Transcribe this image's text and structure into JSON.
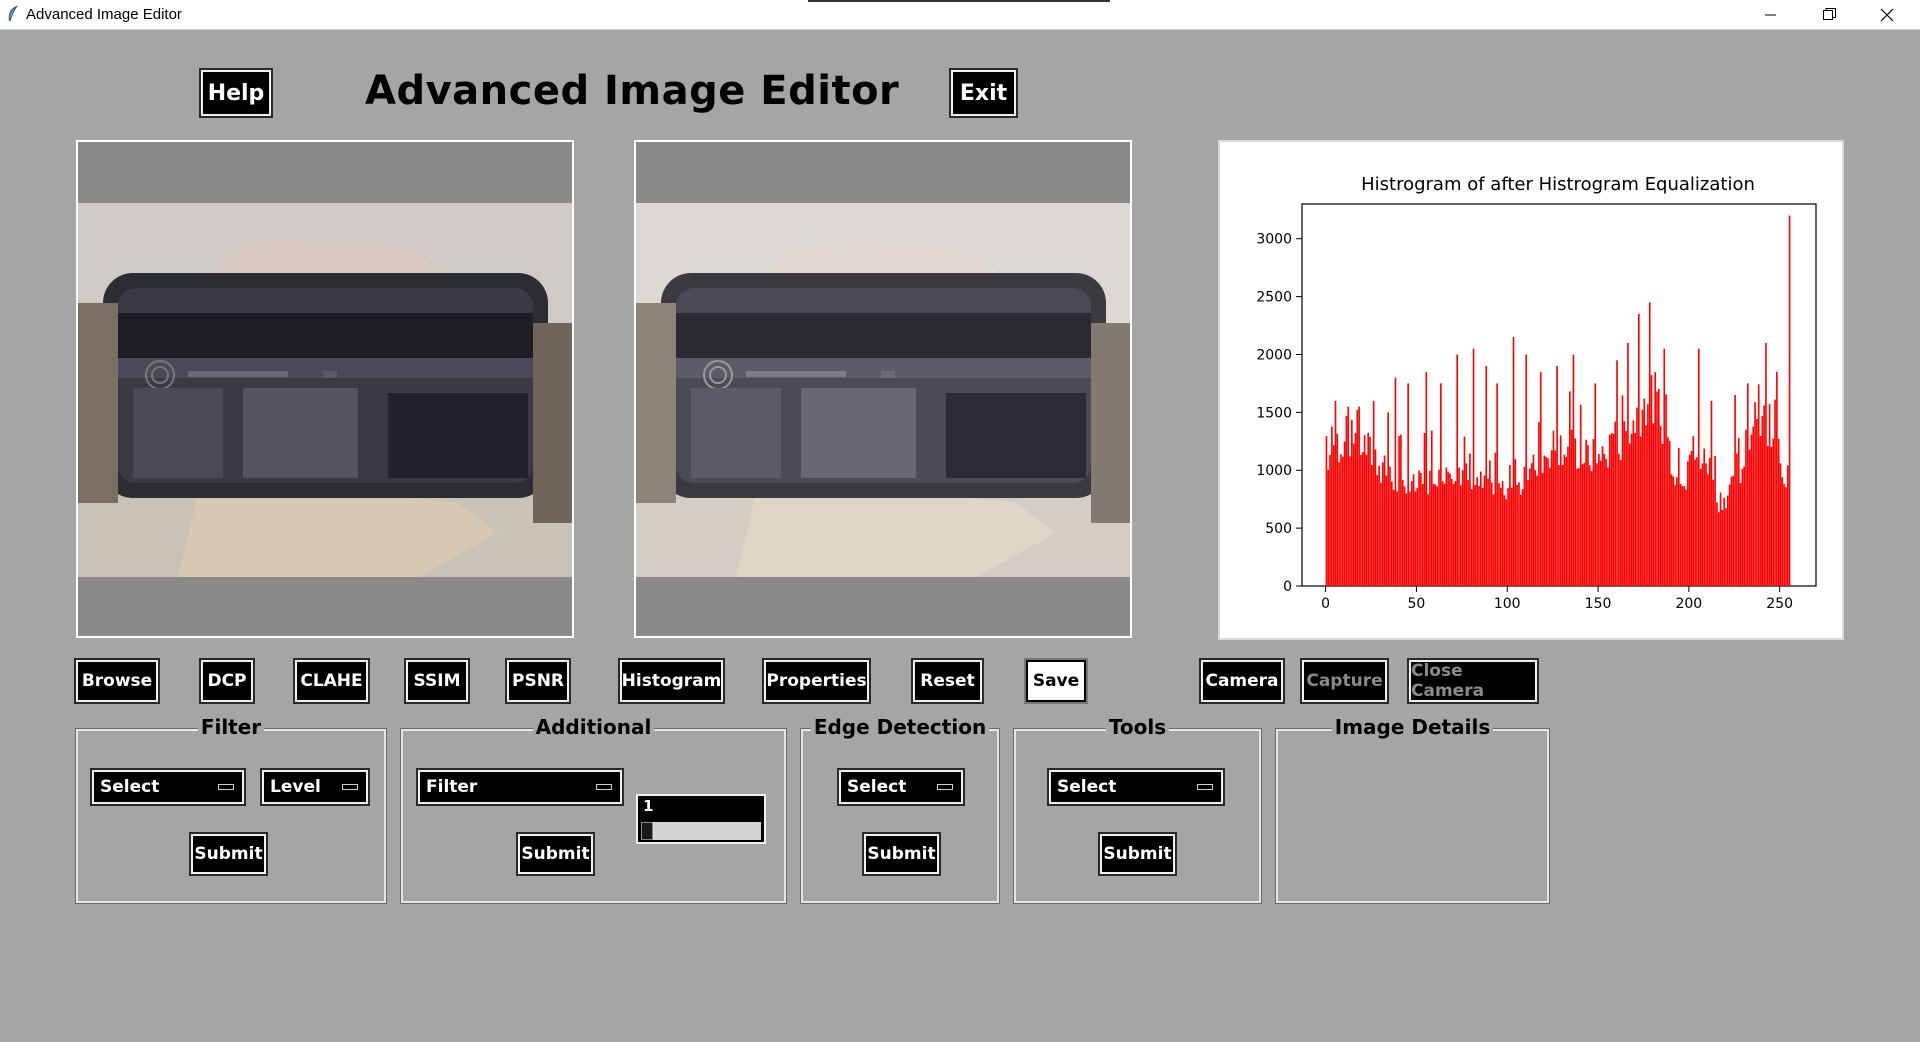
{
  "window": {
    "title": "Advanced Image Editor"
  },
  "header": {
    "title": "Advanced Image Editor",
    "help_label": "Help",
    "exit_label": "Exit"
  },
  "toolbar": {
    "browse": "Browse",
    "dcp": "DCP",
    "clahe": "CLAHE",
    "ssim": "SSIM",
    "psnr": "PSNR",
    "histogram": "Histogram",
    "properties": "Properties",
    "reset": "Reset",
    "save": "Save",
    "camera": "Camera",
    "capture": "Capture",
    "close_camera": "Close Camera"
  },
  "groups": {
    "filter": {
      "title": "Filter",
      "select": "Select",
      "level": "Level",
      "submit": "Submit"
    },
    "additional": {
      "title": "Additional",
      "select": "Filter",
      "scale_value": "1",
      "submit": "Submit"
    },
    "edge": {
      "title": "Edge Detection",
      "select": "Select",
      "submit": "Submit"
    },
    "tools": {
      "title": "Tools",
      "select": "Select",
      "submit": "Submit"
    },
    "details": {
      "title": "Image Details"
    }
  },
  "colors": {
    "background": "#a5a5a5",
    "button": "#000000",
    "histogram_bar": "#ff0000"
  },
  "chart_data": {
    "type": "bar",
    "title": "Histrogram of after Histrogram Equalization",
    "xlabel": "",
    "ylabel": "",
    "xlim": [
      -13,
      270
    ],
    "ylim": [
      0,
      3300
    ],
    "xticks": [
      0,
      50,
      100,
      150,
      200,
      250
    ],
    "yticks": [
      0,
      500,
      1000,
      1500,
      2000,
      2500,
      3000
    ],
    "grid": false,
    "x_range": [
      0,
      255
    ],
    "notes_from_image": "Dense histogram, mostly 800-1500 with many spikes; peaks near 175-180 (~2450) and spike at 255 (~3200).",
    "spikes": [
      {
        "x": 5,
        "y": 1600
      },
      {
        "x": 12,
        "y": 1550
      },
      {
        "x": 18,
        "y": 1550
      },
      {
        "x": 26,
        "y": 1600
      },
      {
        "x": 34,
        "y": 1500
      },
      {
        "x": 38,
        "y": 1800
      },
      {
        "x": 45,
        "y": 1750
      },
      {
        "x": 55,
        "y": 1850
      },
      {
        "x": 63,
        "y": 1750
      },
      {
        "x": 72,
        "y": 2000
      },
      {
        "x": 81,
        "y": 2050
      },
      {
        "x": 88,
        "y": 1900
      },
      {
        "x": 94,
        "y": 1750
      },
      {
        "x": 103,
        "y": 2150
      },
      {
        "x": 110,
        "y": 2000
      },
      {
        "x": 118,
        "y": 1850
      },
      {
        "x": 127,
        "y": 1900
      },
      {
        "x": 136,
        "y": 2000
      },
      {
        "x": 148,
        "y": 1750
      },
      {
        "x": 160,
        "y": 1950
      },
      {
        "x": 166,
        "y": 2100
      },
      {
        "x": 172,
        "y": 2350
      },
      {
        "x": 178,
        "y": 2450
      },
      {
        "x": 186,
        "y": 2050
      },
      {
        "x": 205,
        "y": 2050
      },
      {
        "x": 212,
        "y": 1600
      },
      {
        "x": 225,
        "y": 1650
      },
      {
        "x": 232,
        "y": 1750
      },
      {
        "x": 242,
        "y": 2100
      },
      {
        "x": 248,
        "y": 1850
      },
      {
        "x": 255,
        "y": 3200
      }
    ]
  }
}
